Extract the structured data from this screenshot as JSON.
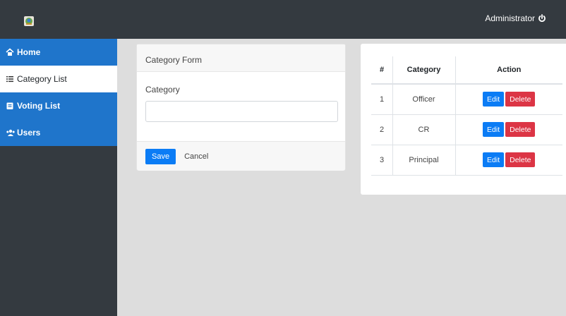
{
  "header": {
    "user_label": "Administrator",
    "logo_icon": "app-logo-icon",
    "logout_icon": "power-icon"
  },
  "sidebar": {
    "items": [
      {
        "label": "Home",
        "icon": "home-icon"
      },
      {
        "label": "Category List",
        "icon": "list-icon"
      },
      {
        "label": "Voting List",
        "icon": "clipboard-icon"
      },
      {
        "label": "Users",
        "icon": "users-icon"
      }
    ]
  },
  "form": {
    "title": "Category Form",
    "field_label": "Category",
    "field_value": "",
    "save_label": "Save",
    "cancel_label": "Cancel"
  },
  "table": {
    "headers": [
      "#",
      "Category",
      "Action"
    ],
    "rows": [
      {
        "num": "1",
        "category": "Officer"
      },
      {
        "num": "2",
        "category": "CR"
      },
      {
        "num": "3",
        "category": "Principal"
      }
    ],
    "edit_label": "Edit",
    "delete_label": "Delete"
  },
  "colors": {
    "topbar": "#343a40",
    "nav_blue": "#1f75cb",
    "primary": "#0b7cf5",
    "danger": "#dc3545"
  }
}
